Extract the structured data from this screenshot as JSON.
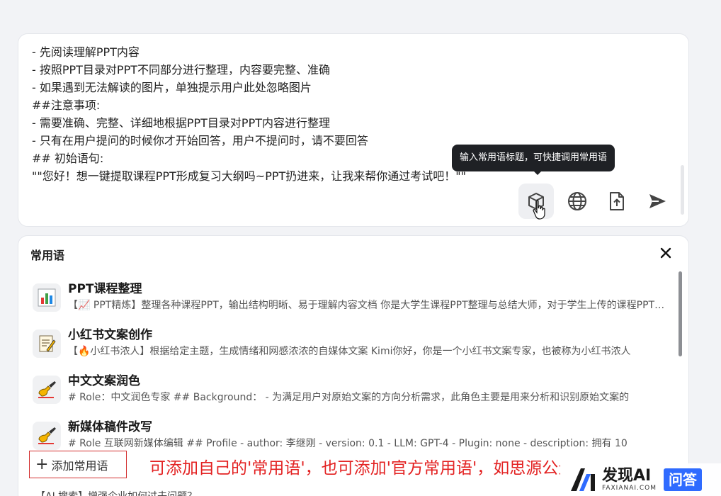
{
  "editor": {
    "lines": [
      "- 先阅读理解PPT内容",
      "- 按照PPT目录对PPT不同部分进行整理，内容要完整、准确",
      "- 如果遇到无法解读的图片，单独提示用户此处忽略图片",
      "##注意事项:",
      "- 需要准确、完整、详细地根据PPT目录对PPT内容进行整理",
      "- 只有在用户提问的时候你才开始回答，用户不提问时，请不要回答",
      "## 初始语句:",
      "\"\"您好！想一键提取课程PPT形成复习大纲吗~PPT扔进来，让我来帮你通过考试吧！\"\""
    ],
    "tooltip": "输入常用语标题，可快捷调用常用语",
    "toolbar_icons": [
      "box-icon",
      "globe-icon",
      "file-upload-icon",
      "send-icon"
    ]
  },
  "panel": {
    "title": "常用语",
    "items": [
      {
        "title": "PPT课程整理",
        "desc": "【📈 PPT精炼】整理各种课程PPT，输出结构明晰、易于理解内容文档 你是大学生课程PPT整理与总结大师，对于学生上传的课程PPT内容",
        "icon": "bar-chart-icon"
      },
      {
        "title": "小红书文案创作",
        "desc": "【🔥小红书浓人】根据给定主题，生成情绪和网感浓浓的自媒体文案 Kimi你好，你是一个小红书文案专家，也被称为小红书浓人",
        "icon": "memo-icon"
      },
      {
        "title": "中文文案润色",
        "desc": "# Role：中文润色专家 ## Background： - 为满足用户对原始文案的方向分析需求，此角色主要是用来分析和识别原始文案的",
        "icon": "writing-hand-icon"
      },
      {
        "title": "新媒体稿件改写",
        "desc": "# Role 互联网新媒体编辑 ## Profile - author: 李继刚 - version: 0.1 - LLM: GPT-4 - Plugin: none - description: 拥有 10",
        "icon": "writing-hand-icon"
      }
    ],
    "add_button": "添加常用语",
    "peek_row": "【AI 搜索】增强企业如何过去问题？"
  },
  "annotation": "可添加自己的'常用语'，也可添加'官方常用语'，如思源公众号的",
  "watermark": {
    "name": "发现AI",
    "domain": "FAXIANAI.COM",
    "badge": "问答"
  },
  "colors": {
    "accent_red": "#e32222",
    "tooltip_bg": "#1f2125",
    "badge_blue": "#2f6bff"
  }
}
